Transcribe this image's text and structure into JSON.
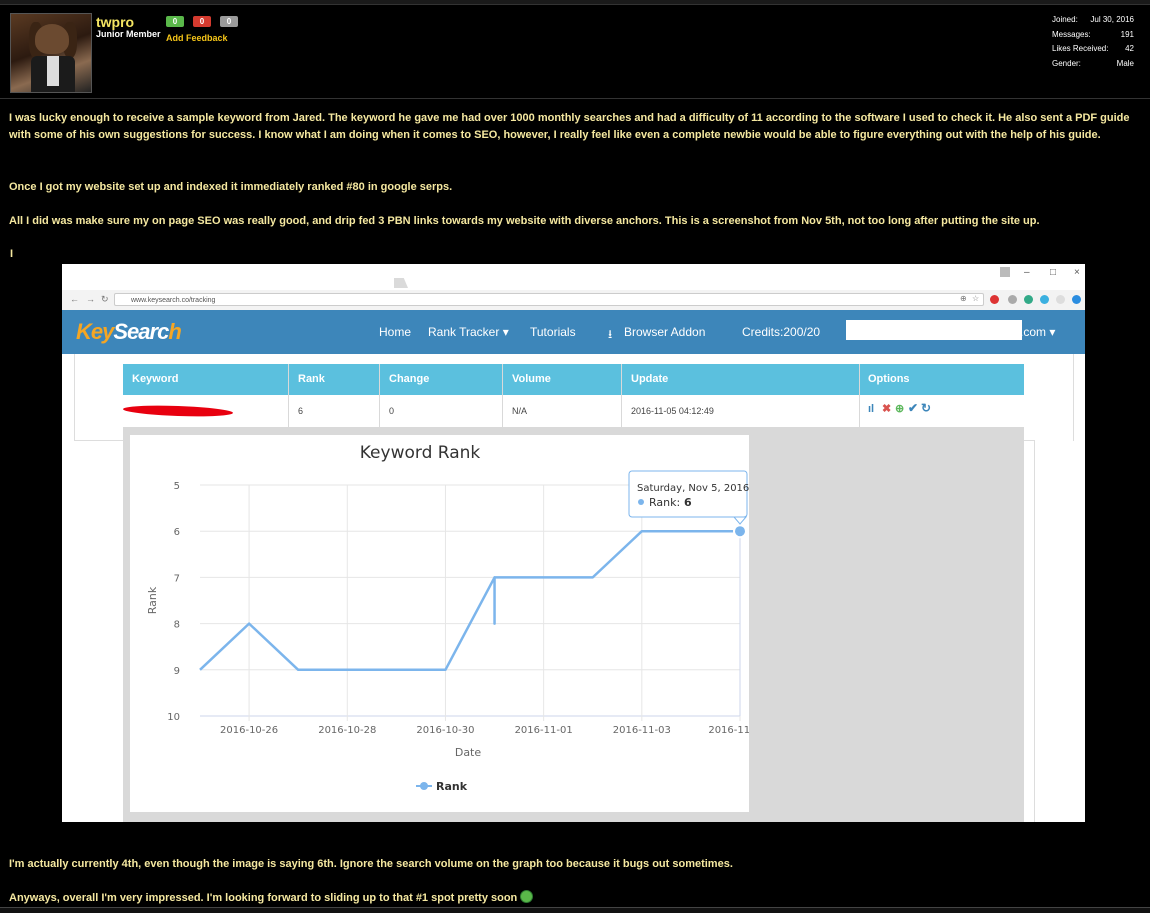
{
  "post": {
    "username": "twpro",
    "user_title": "Junior Member",
    "feedback": {
      "positive": "0",
      "negative": "0",
      "neutral": "0",
      "add_label": "Add Feedback"
    },
    "stats": [
      {
        "label": "Joined:",
        "value": "Jul 30, 2016"
      },
      {
        "label": "Messages:",
        "value": "191"
      },
      {
        "label": "Likes Received:",
        "value": "42"
      },
      {
        "label": "Gender:",
        "value": "Male"
      }
    ],
    "paragraphs": [
      "I was lucky enough to receive a sample keyword from Jared. The keyword he gave me had over 1000 monthly searches and had a difficulty of 11 according to the software I used to check it. He also sent a PDF guide with some of his own suggestions for success. I know what I am doing when it comes to SEO, however, I really feel like even a complete newbie would be able to figure everything out with the help of his guide.",
      "Once I got my website set up and indexed it immediately ranked #80 in google serps.",
      "All I did was make sure my on page SEO was really good, and drip fed 3 PBN links towards my website with diverse anchors. This is a screenshot from Nov 5th, not too long after putting the site up.",
      "I",
      "I'm actually currently 4th, even though the image is saying 6th. Ignore the search volume on the graph too because it bugs out sometimes.",
      "Anyways, overall I'm very impressed. I'm looking forward to sliding up to that #1 spot pretty soon"
    ]
  },
  "screenshot": {
    "browser": {
      "url": "www.keysearch.co/tracking"
    },
    "nav": {
      "logo_key": "Key",
      "logo_search": "Searc",
      "logo_end": "h",
      "items": [
        "Home",
        "Rank Tracker ▾",
        "Tutorials",
        "Browser Addon",
        "Credits:200/20"
      ],
      "account_suffix": ".com ▾"
    },
    "table": {
      "headers": [
        "Keyword",
        "Rank",
        "Change",
        "Volume",
        "Update",
        "Options"
      ],
      "row": {
        "rank": "6",
        "change": "0",
        "volume": "N/A",
        "update": "2016-11-05 04:12:49"
      }
    }
  },
  "chart_data": {
    "type": "line",
    "title": "Keyword Rank",
    "xlabel": "Date",
    "ylabel": "Rank",
    "y_reversed": true,
    "ylim": [
      5,
      10
    ],
    "y_ticks": [
      "5",
      "6",
      "7",
      "8",
      "9",
      "10"
    ],
    "x_ticks": [
      "2016-10-26",
      "2016-10-28",
      "2016-10-30",
      "2016-11-01",
      "2016-11-03",
      "2016-11..."
    ],
    "grid": true,
    "legend_position": "bottom",
    "series": [
      {
        "name": "Rank",
        "color": "#7cb5ec",
        "x": [
          "2016-10-25",
          "2016-10-26",
          "2016-10-27",
          "2016-10-28",
          "2016-10-29",
          "2016-10-30",
          "2016-10-31",
          "2016-10-31",
          "2016-10-31",
          "2016-11-01",
          "2016-11-02",
          "2016-11-03",
          "2016-11-04",
          "2016-11-05"
        ],
        "values": [
          9,
          8,
          9,
          9,
          9,
          9,
          7,
          8,
          7,
          7,
          7,
          6,
          6,
          6
        ]
      }
    ],
    "tooltip": {
      "date": "Saturday, Nov 5, 2016",
      "label": "Rank",
      "value": "6"
    }
  }
}
